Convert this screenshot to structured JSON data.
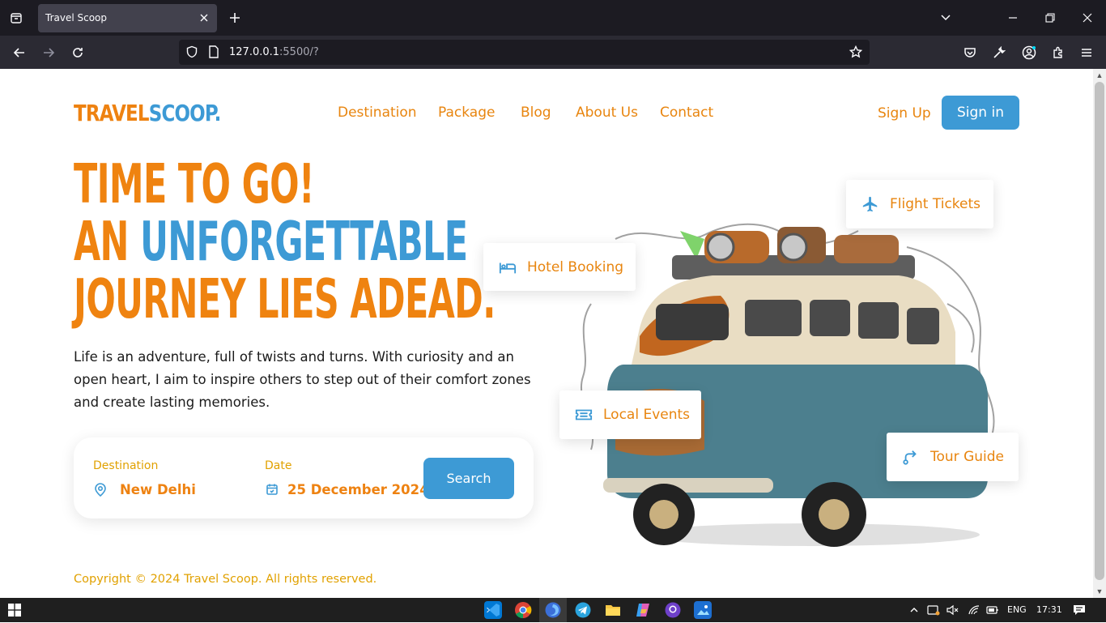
{
  "browser": {
    "tab_title": "Travel Scoop",
    "url_host": "127.0.0.1",
    "url_rest": ":5500/?"
  },
  "brand": {
    "logo_part1": "TRAVEL",
    "logo_part2": "SCOOP",
    "logo_dot": "."
  },
  "nav": {
    "items": [
      "Destination",
      "Package",
      "Blog",
      "About Us",
      "Contact"
    ],
    "signup": "Sign Up",
    "signin": "Sign in"
  },
  "hero": {
    "line1": "TIME TO GO!",
    "line2_a": "AN ",
    "line2_b": "UNFORGETTABLE",
    "line3": "JOURNEY LIES ADEAD.",
    "description": "Life is an adventure, full of twists and turns. With curiosity and an open heart, I aim to inspire others to step out of their comfort zones and create lasting memories."
  },
  "search": {
    "destination_label": "Destination",
    "destination_value": "New Delhi",
    "date_label": "Date",
    "date_value": "25 December 2024",
    "button": "Search"
  },
  "badges": {
    "flight": "Flight Tickets",
    "hotel": "Hotel Booking",
    "events": "Local Events",
    "tour": "Tour Guide"
  },
  "footer": {
    "copyright": "Copyright © 2024 Travel Scoop. All rights reserved."
  },
  "taskbar": {
    "lang": "ENG",
    "time": "17:31"
  },
  "colors": {
    "orange": "#ee8211",
    "blue": "#3d9ad5",
    "gold": "#e1a100"
  }
}
